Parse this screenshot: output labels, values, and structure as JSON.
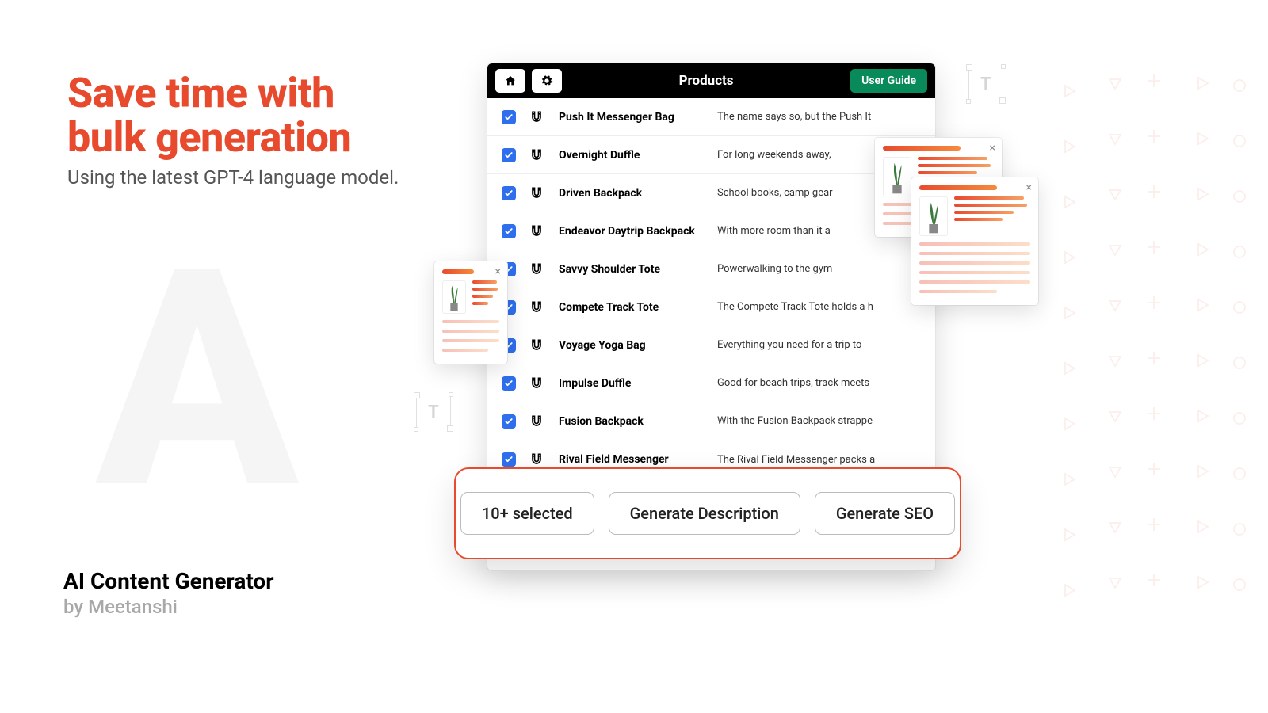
{
  "headline_line1": "Save time with",
  "headline_line2": "bulk generation",
  "subhead": "Using the latest GPT-4 language model.",
  "brand": {
    "name": "AI Content Generator",
    "by": "by Meetanshi"
  },
  "window": {
    "title": "Products",
    "guide_label": "User Guide",
    "rows": [
      {
        "name": "Push It Messenger Bag",
        "desc": "The name says so, but the Push It"
      },
      {
        "name": "Overnight Duffle",
        "desc": "For long weekends away,"
      },
      {
        "name": "Driven Backpack",
        "desc": "School books, camp gear"
      },
      {
        "name": "Endeavor Daytrip Backpack",
        "desc": "With more room than it a"
      },
      {
        "name": "Savvy Shoulder Tote",
        "desc": "Powerwalking to the gym"
      },
      {
        "name": "Compete Track Tote",
        "desc": "The Compete Track Tote holds a h"
      },
      {
        "name": "Voyage Yoga Bag",
        "desc": "Everything you need for a trip to"
      },
      {
        "name": "Impulse Duffle",
        "desc": "Good for beach trips, track meets"
      },
      {
        "name": "Fusion Backpack",
        "desc": "With the Fusion Backpack strappe"
      },
      {
        "name": "Rival Field Messenger",
        "desc": "The Rival Field Messenger packs a"
      }
    ]
  },
  "actions": {
    "selected_label": "10+ selected",
    "gen_desc_label": "Generate Description",
    "gen_seo_label": "Generate SEO"
  },
  "decor": {
    "t_glyph": "T",
    "bg_glyph": "A"
  }
}
